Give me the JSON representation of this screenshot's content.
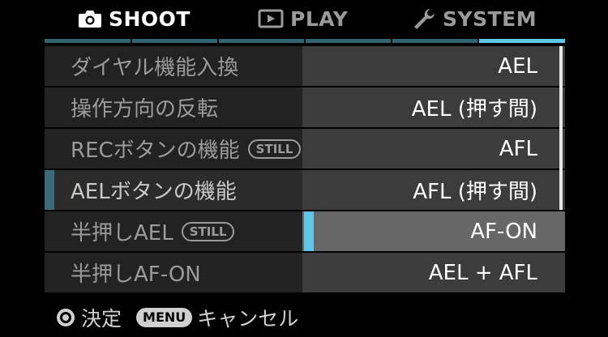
{
  "tabs": [
    {
      "label": "SHOOT",
      "icon": "camera-icon",
      "active": true
    },
    {
      "label": "PLAY",
      "icon": "play-icon",
      "active": false
    },
    {
      "label": "SYSTEM",
      "icon": "wrench-icon",
      "active": false
    }
  ],
  "menu_items": [
    {
      "label": "ダイヤル機能入換",
      "badge": ""
    },
    {
      "label": "操作方向の反転",
      "badge": ""
    },
    {
      "label": "RECボタンの機能",
      "badge": "STILL"
    },
    {
      "label": "AELボタンの機能",
      "badge": "",
      "selected": true
    },
    {
      "label": "半押しAEL",
      "badge": "STILL"
    },
    {
      "label": "半押しAF-ON",
      "badge": ""
    }
  ],
  "dropdown_options": [
    {
      "label": "AEL"
    },
    {
      "label": "AEL (押す間)"
    },
    {
      "label": "AFL"
    },
    {
      "label": "AFL (押す間)"
    },
    {
      "label": "AF-ON",
      "highlighted": true
    },
    {
      "label": "AEL + AFL"
    }
  ],
  "footer": {
    "confirm_label": "決定",
    "menu_badge": "MENU",
    "cancel_label": "キャンセル"
  },
  "colors": {
    "accent": "#5ec6e8",
    "tab_bar_inactive": "#2f6470",
    "row_bg": "#222222",
    "dropdown_bg": "#3c3c3c",
    "dropdown_highlight": "#676767"
  }
}
